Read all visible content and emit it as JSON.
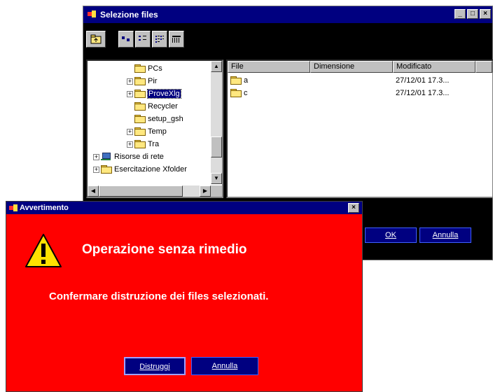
{
  "files_window": {
    "title": "Selezione files",
    "controls": {
      "minimize": "_",
      "maximize": "□",
      "close": "×"
    },
    "toolbar": {
      "buttons": [
        "up-folder-icon",
        "large-icons-view-icon",
        "small-icons-view-icon",
        "list-view-icon",
        "details-view-icon"
      ]
    },
    "tree": {
      "items": [
        {
          "label": "PCs",
          "expander": ""
        },
        {
          "label": "Pir",
          "expander": "+"
        },
        {
          "label": "ProveXlg",
          "expander": "+"
        },
        {
          "label": "Recycler",
          "expander": ""
        },
        {
          "label": "setup_gsh",
          "expander": ""
        },
        {
          "label": "Temp",
          "expander": "+"
        },
        {
          "label": "Tra",
          "expander": "+"
        },
        {
          "label": "Risorse di rete",
          "expander": "+"
        },
        {
          "label": "Esercitazione Xfolder",
          "expander": "+"
        }
      ],
      "selected": "ProveXlg"
    },
    "list": {
      "columns": [
        "File",
        "Dimensione",
        "Modificato"
      ],
      "rows": [
        {
          "name": "a",
          "size": "",
          "modified": "27/12/01 17.3..."
        },
        {
          "name": "c",
          "size": "",
          "modified": "27/12/01 17.3..."
        }
      ]
    },
    "buttons": {
      "ok": "OK",
      "cancel": "Annulla"
    }
  },
  "warning_dialog": {
    "title": "Avvertimento",
    "close": "×",
    "heading": "Operazione senza rimedio",
    "message": "Confermare distruzione dei files selezionati.",
    "buttons": {
      "destroy": "Distruggi",
      "cancel": "Annulla"
    },
    "background_color": "#ff0000"
  }
}
